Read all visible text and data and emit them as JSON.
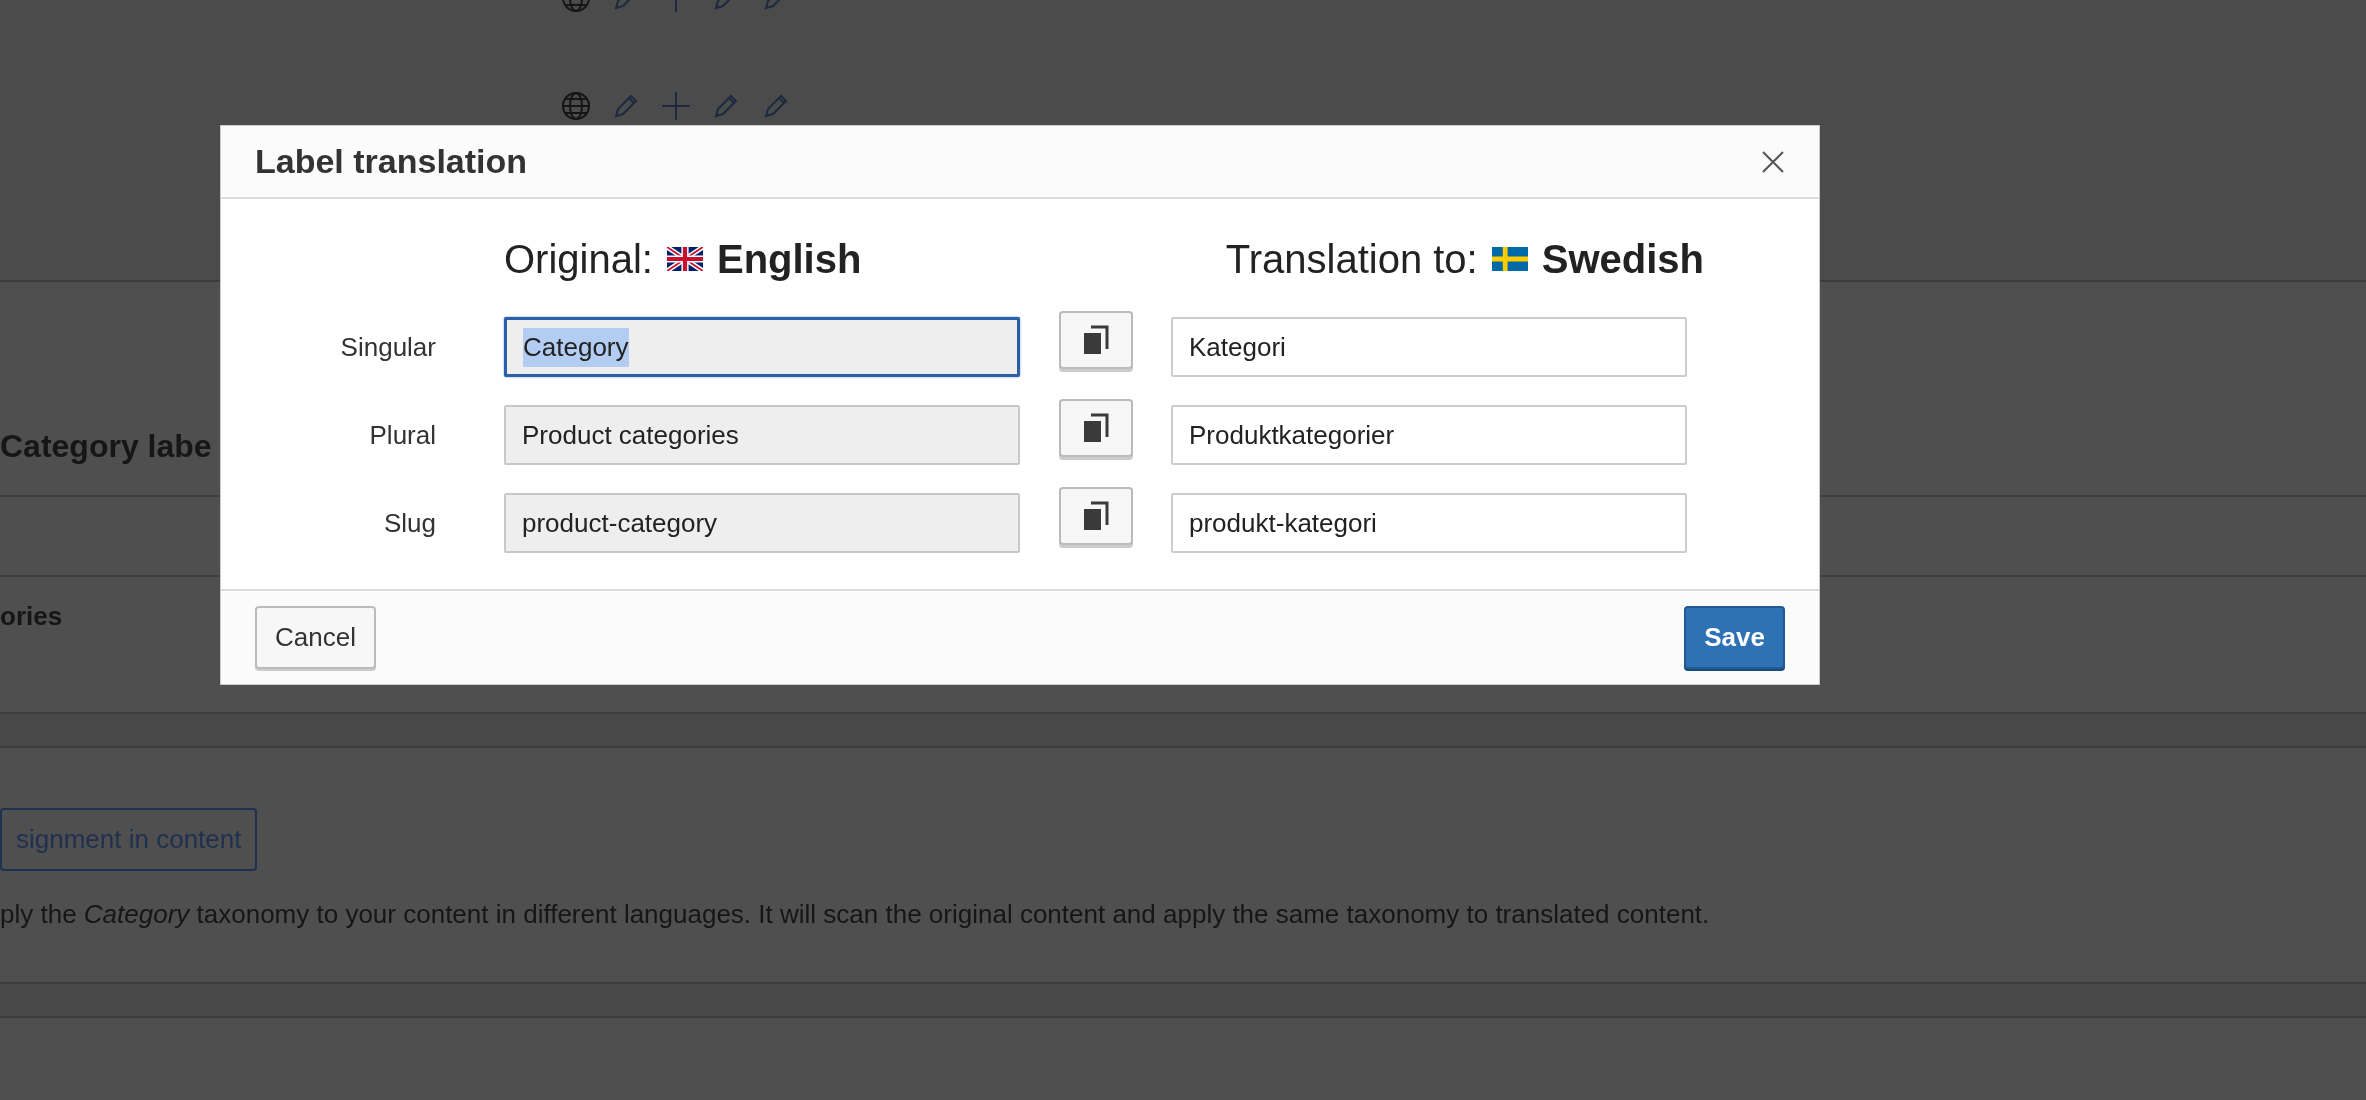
{
  "background": {
    "heading": "Category labe",
    "subheading": "ories",
    "assign_button": "signment in content",
    "description": "ply the *Category* taxonomy to your content in different languages. It will scan the original content and apply the same taxonomy to translated content."
  },
  "dialog": {
    "title": "Label translation",
    "original_header": {
      "label": "Original:",
      "language": "English"
    },
    "translation_header": {
      "label": "Translation to:",
      "language": "Swedish"
    },
    "rows": [
      {
        "label": "Singular",
        "original": {
          "value": "Category",
          "readonly": true,
          "focused": true,
          "text_selected": true
        },
        "translation": {
          "value": "Kategori",
          "readonly": false
        }
      },
      {
        "label": "Plural",
        "original": {
          "value": "Product categories",
          "readonly": true,
          "focused": false,
          "text_selected": false
        },
        "translation": {
          "value": "Produktkategorier",
          "readonly": false
        }
      },
      {
        "label": "Slug",
        "original": {
          "value": "product-category",
          "readonly": true,
          "focused": false,
          "text_selected": false
        },
        "translation": {
          "value": "produkt-kategori",
          "readonly": false
        }
      }
    ],
    "cancel_button": "Cancel",
    "save_button": "Save"
  }
}
